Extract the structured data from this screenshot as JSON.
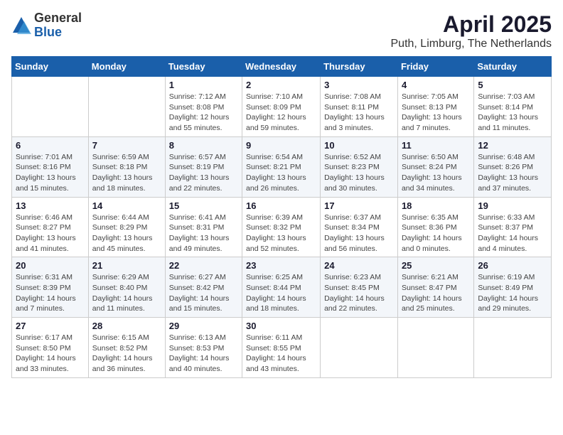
{
  "logo": {
    "general": "General",
    "blue": "Blue"
  },
  "title": "April 2025",
  "subtitle": "Puth, Limburg, The Netherlands",
  "days_header": [
    "Sunday",
    "Monday",
    "Tuesday",
    "Wednesday",
    "Thursday",
    "Friday",
    "Saturday"
  ],
  "weeks": [
    {
      "shaded": false,
      "days": [
        {
          "num": "",
          "info": ""
        },
        {
          "num": "",
          "info": ""
        },
        {
          "num": "1",
          "info": "Sunrise: 7:12 AM\nSunset: 8:08 PM\nDaylight: 12 hours and 55 minutes."
        },
        {
          "num": "2",
          "info": "Sunrise: 7:10 AM\nSunset: 8:09 PM\nDaylight: 12 hours and 59 minutes."
        },
        {
          "num": "3",
          "info": "Sunrise: 7:08 AM\nSunset: 8:11 PM\nDaylight: 13 hours and 3 minutes."
        },
        {
          "num": "4",
          "info": "Sunrise: 7:05 AM\nSunset: 8:13 PM\nDaylight: 13 hours and 7 minutes."
        },
        {
          "num": "5",
          "info": "Sunrise: 7:03 AM\nSunset: 8:14 PM\nDaylight: 13 hours and 11 minutes."
        }
      ]
    },
    {
      "shaded": true,
      "days": [
        {
          "num": "6",
          "info": "Sunrise: 7:01 AM\nSunset: 8:16 PM\nDaylight: 13 hours and 15 minutes."
        },
        {
          "num": "7",
          "info": "Sunrise: 6:59 AM\nSunset: 8:18 PM\nDaylight: 13 hours and 18 minutes."
        },
        {
          "num": "8",
          "info": "Sunrise: 6:57 AM\nSunset: 8:19 PM\nDaylight: 13 hours and 22 minutes."
        },
        {
          "num": "9",
          "info": "Sunrise: 6:54 AM\nSunset: 8:21 PM\nDaylight: 13 hours and 26 minutes."
        },
        {
          "num": "10",
          "info": "Sunrise: 6:52 AM\nSunset: 8:23 PM\nDaylight: 13 hours and 30 minutes."
        },
        {
          "num": "11",
          "info": "Sunrise: 6:50 AM\nSunset: 8:24 PM\nDaylight: 13 hours and 34 minutes."
        },
        {
          "num": "12",
          "info": "Sunrise: 6:48 AM\nSunset: 8:26 PM\nDaylight: 13 hours and 37 minutes."
        }
      ]
    },
    {
      "shaded": false,
      "days": [
        {
          "num": "13",
          "info": "Sunrise: 6:46 AM\nSunset: 8:27 PM\nDaylight: 13 hours and 41 minutes."
        },
        {
          "num": "14",
          "info": "Sunrise: 6:44 AM\nSunset: 8:29 PM\nDaylight: 13 hours and 45 minutes."
        },
        {
          "num": "15",
          "info": "Sunrise: 6:41 AM\nSunset: 8:31 PM\nDaylight: 13 hours and 49 minutes."
        },
        {
          "num": "16",
          "info": "Sunrise: 6:39 AM\nSunset: 8:32 PM\nDaylight: 13 hours and 52 minutes."
        },
        {
          "num": "17",
          "info": "Sunrise: 6:37 AM\nSunset: 8:34 PM\nDaylight: 13 hours and 56 minutes."
        },
        {
          "num": "18",
          "info": "Sunrise: 6:35 AM\nSunset: 8:36 PM\nDaylight: 14 hours and 0 minutes."
        },
        {
          "num": "19",
          "info": "Sunrise: 6:33 AM\nSunset: 8:37 PM\nDaylight: 14 hours and 4 minutes."
        }
      ]
    },
    {
      "shaded": true,
      "days": [
        {
          "num": "20",
          "info": "Sunrise: 6:31 AM\nSunset: 8:39 PM\nDaylight: 14 hours and 7 minutes."
        },
        {
          "num": "21",
          "info": "Sunrise: 6:29 AM\nSunset: 8:40 PM\nDaylight: 14 hours and 11 minutes."
        },
        {
          "num": "22",
          "info": "Sunrise: 6:27 AM\nSunset: 8:42 PM\nDaylight: 14 hours and 15 minutes."
        },
        {
          "num": "23",
          "info": "Sunrise: 6:25 AM\nSunset: 8:44 PM\nDaylight: 14 hours and 18 minutes."
        },
        {
          "num": "24",
          "info": "Sunrise: 6:23 AM\nSunset: 8:45 PM\nDaylight: 14 hours and 22 minutes."
        },
        {
          "num": "25",
          "info": "Sunrise: 6:21 AM\nSunset: 8:47 PM\nDaylight: 14 hours and 25 minutes."
        },
        {
          "num": "26",
          "info": "Sunrise: 6:19 AM\nSunset: 8:49 PM\nDaylight: 14 hours and 29 minutes."
        }
      ]
    },
    {
      "shaded": false,
      "days": [
        {
          "num": "27",
          "info": "Sunrise: 6:17 AM\nSunset: 8:50 PM\nDaylight: 14 hours and 33 minutes."
        },
        {
          "num": "28",
          "info": "Sunrise: 6:15 AM\nSunset: 8:52 PM\nDaylight: 14 hours and 36 minutes."
        },
        {
          "num": "29",
          "info": "Sunrise: 6:13 AM\nSunset: 8:53 PM\nDaylight: 14 hours and 40 minutes."
        },
        {
          "num": "30",
          "info": "Sunrise: 6:11 AM\nSunset: 8:55 PM\nDaylight: 14 hours and 43 minutes."
        },
        {
          "num": "",
          "info": ""
        },
        {
          "num": "",
          "info": ""
        },
        {
          "num": "",
          "info": ""
        }
      ]
    }
  ]
}
